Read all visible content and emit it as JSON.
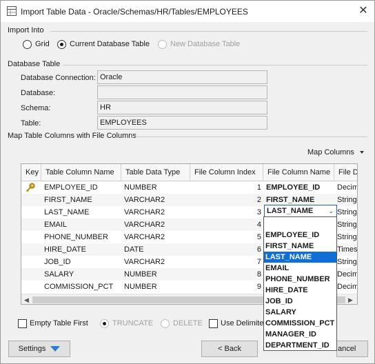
{
  "window": {
    "title": "Import Table Data - Oracle/Schemas/HR/Tables/EMPLOYEES",
    "close_glyph": "✕"
  },
  "import_into": {
    "label": "Import Into",
    "options": [
      {
        "label": "Grid",
        "checked": false,
        "enabled": true
      },
      {
        "label": "Current Database Table",
        "checked": true,
        "enabled": true
      },
      {
        "label": "New Database Table",
        "checked": false,
        "enabled": false
      }
    ]
  },
  "database_table": {
    "label": "Database Table",
    "connection": {
      "label": "Database Connection:",
      "value": "Oracle"
    },
    "database": {
      "label": "Database:",
      "value": ""
    },
    "schema": {
      "label": "Schema:",
      "value": "HR"
    },
    "table": {
      "label": "Table:",
      "value": "EMPLOYEES"
    }
  },
  "map": {
    "label": "Map Table Columns with File Columns",
    "map_columns_button": "Map Columns",
    "headers": [
      "Key",
      "Table Column Name",
      "Table Data Type",
      "File Column Index",
      "File Column Name",
      "File D"
    ],
    "rows": [
      {
        "key": true,
        "col": "EMPLOYEE_ID",
        "type": "NUMBER",
        "index": "1",
        "file_col": "EMPLOYEE_ID",
        "file_type": "Decim"
      },
      {
        "key": false,
        "col": "FIRST_NAME",
        "type": "VARCHAR2",
        "index": "2",
        "file_col": "FIRST_NAME",
        "file_type": "String"
      },
      {
        "key": false,
        "col": "LAST_NAME",
        "type": "VARCHAR2",
        "index": "3",
        "file_col": "LAST_NAME",
        "file_type": "String"
      },
      {
        "key": false,
        "col": "EMAIL",
        "type": "VARCHAR2",
        "index": "4",
        "file_col": "",
        "file_type": "String"
      },
      {
        "key": false,
        "col": "PHONE_NUMBER",
        "type": "VARCHAR2",
        "index": "5",
        "file_col": "",
        "file_type": "String"
      },
      {
        "key": false,
        "col": "HIRE_DATE",
        "type": "DATE",
        "index": "6",
        "file_col": "",
        "file_type": "Times"
      },
      {
        "key": false,
        "col": "JOB_ID",
        "type": "VARCHAR2",
        "index": "7",
        "file_col": "",
        "file_type": "String"
      },
      {
        "key": false,
        "col": "SALARY",
        "type": "NUMBER",
        "index": "8",
        "file_col": "",
        "file_type": "Decim"
      },
      {
        "key": false,
        "col": "COMMISSION_PCT",
        "type": "NUMBER",
        "index": "9",
        "file_col": "",
        "file_type": "Decim"
      }
    ],
    "combo_value": "LAST_NAME",
    "dropdown_options": [
      "",
      "EMPLOYEE_ID",
      "FIRST_NAME",
      "LAST_NAME",
      "EMAIL",
      "PHONE_NUMBER",
      "HIRE_DATE",
      "JOB_ID",
      "SALARY",
      "COMMISSION_PCT",
      "MANAGER_ID",
      "DEPARTMENT_ID"
    ],
    "dropdown_highlighted": "LAST_NAME"
  },
  "options_row": {
    "empty_table_first": "Empty Table First",
    "truncate": "TRUNCATE",
    "delete": "DELETE",
    "use_delimited": "Use Delimite"
  },
  "footer": {
    "settings": "Settings",
    "back": "< Back",
    "cancel": "ancel"
  }
}
